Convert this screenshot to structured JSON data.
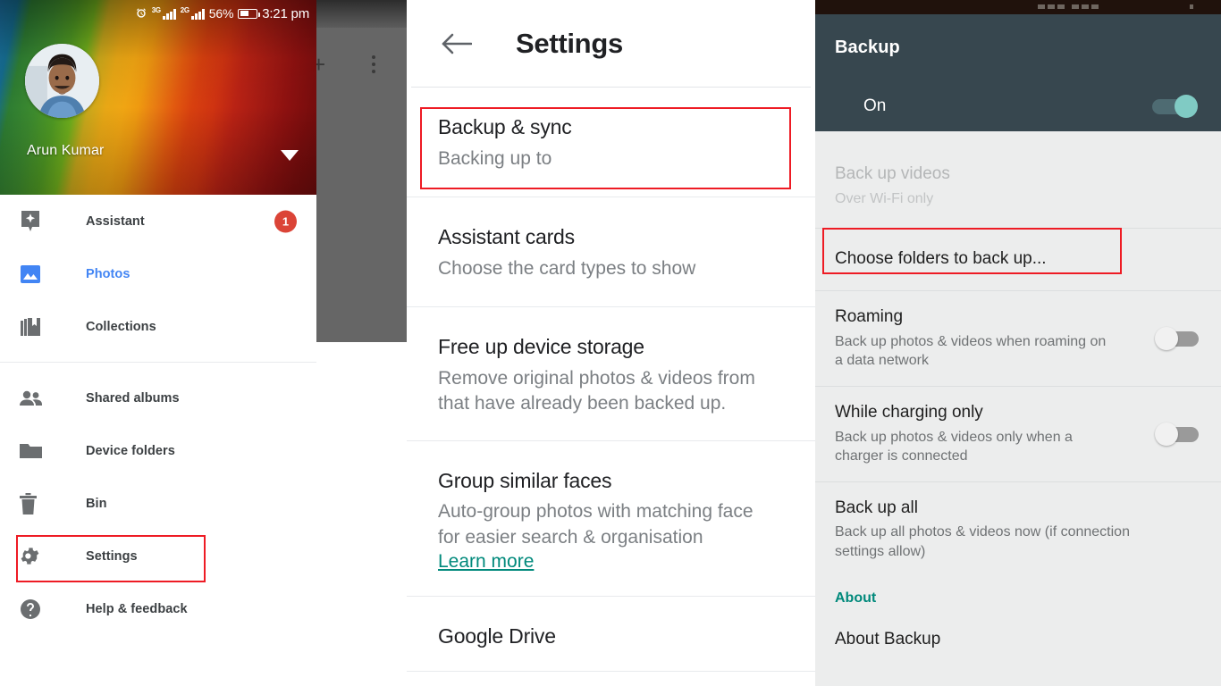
{
  "left_panel": {
    "status_bar": {
      "alarm_icon": "alarm-clock-icon",
      "network_1": "3G",
      "network_2": "2G",
      "battery_percent": "56%",
      "battery_icon": "battery-icon",
      "time": "3:21 pm"
    },
    "drawer": {
      "account_name": "Arun Kumar",
      "avatar_icon": "user-avatar",
      "expand_icon": "chevron-down-icon",
      "items": [
        {
          "label": "Assistant",
          "icon": "assistant-sparkle-icon",
          "badge": "1",
          "active": false
        },
        {
          "label": "Photos",
          "icon": "photos-image-icon",
          "badge": "",
          "active": true
        },
        {
          "label": "Collections",
          "icon": "collections-book-icon",
          "badge": "",
          "active": false
        }
      ],
      "items2": [
        {
          "label": "Shared albums",
          "icon": "people-icon",
          "badge": "",
          "active": false
        },
        {
          "label": "Device folders",
          "icon": "folder-icon",
          "badge": "",
          "active": false
        },
        {
          "label": "Bin",
          "icon": "trash-bin-icon",
          "badge": "",
          "active": false
        },
        {
          "label": "Settings",
          "icon": "gear-icon",
          "badge": "",
          "active": false,
          "highlighted": true
        },
        {
          "label": "Help & feedback",
          "icon": "help-question-icon",
          "badge": "",
          "active": false
        }
      ]
    },
    "overlay": {
      "add_icon": "plus-icon",
      "overflow_icon": "more-vertical-icon"
    }
  },
  "middle_panel": {
    "back_icon": "back-arrow-icon",
    "title": "Settings",
    "rows": [
      {
        "title": "Backup & sync",
        "sub": "Backing up to",
        "link": "",
        "highlighted": true
      },
      {
        "title": "Assistant cards",
        "sub": "Choose the card types to show",
        "link": "",
        "highlighted": false
      },
      {
        "title": "Free up device storage",
        "sub": "Remove original photos & videos from\nthat have already been backed up.",
        "link": "",
        "highlighted": false
      },
      {
        "title": "Group similar faces",
        "sub": "Auto-group photos with matching face\nfor easier search & organisation",
        "link": "Learn more",
        "highlighted": false
      },
      {
        "title": "Google Drive",
        "sub": "",
        "link": "",
        "highlighted": false
      }
    ]
  },
  "right_panel": {
    "header_title": "Backup",
    "master_toggle": {
      "label": "On",
      "state": "on"
    },
    "rows": [
      {
        "title": "Back up videos",
        "sub": "Over Wi-Fi only",
        "disabled": true,
        "toggle": "none",
        "highlighted": false
      },
      {
        "title": "Choose folders to back up...",
        "sub": "",
        "disabled": false,
        "toggle": "none",
        "highlighted": true
      },
      {
        "title": "Roaming",
        "sub": "Back up photos & videos when roaming on\na data network",
        "disabled": false,
        "toggle": "off",
        "highlighted": false
      },
      {
        "title": "While charging only",
        "sub": "Back up photos & videos only when a\ncharger is connected",
        "disabled": false,
        "toggle": "off",
        "highlighted": false
      },
      {
        "title": "Back up all",
        "sub": "Back up all photos & videos now (if connection\nsettings allow)",
        "disabled": false,
        "toggle": "none",
        "highlighted": false
      }
    ],
    "section_about": "About",
    "about_item": "About Backup"
  },
  "colors": {
    "highlight_red": "#ee1b24",
    "accent_blue": "#4285f4",
    "accent_teal": "#00897b",
    "badge_red": "#db4437",
    "header_slate": "#37474f",
    "toggle_on_teal": "#80cbc4"
  }
}
